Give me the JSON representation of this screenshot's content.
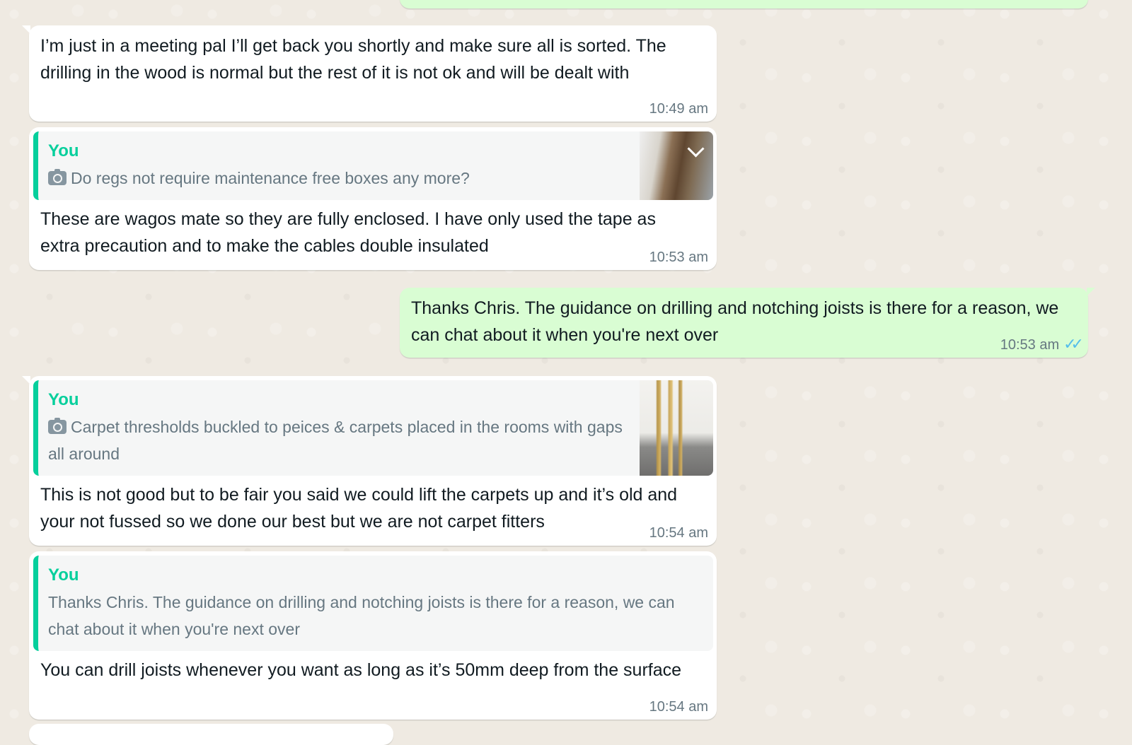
{
  "messages": [
    {
      "text": "I’m just in a meeting pal I’ll get back you shortly and make sure all is sorted. The drilling in the wood is normal but the rest of it is not ok and will be dealt with",
      "time": "10:49 am"
    },
    {
      "quote_author": "You",
      "quote_text": "Do regs not require maintenance free boxes any more?",
      "text": "These are wagos mate so they are fully enclosed. I have only used the tape as extra precaution and to make the cables double insulated",
      "time": "10:53 am"
    },
    {
      "text": "Thanks Chris. The guidance on drilling and notching joists is there for a reason, we can chat about it when you're next over",
      "time": "10:53 am"
    },
    {
      "quote_author": "You",
      "quote_text": "Carpet thresholds buckled to peices & carpets placed in the rooms with gaps all around",
      "text": "This is not good but to be fair you said we could lift the carpets up and it’s old and your not fussed so we done our best but we are not carpet fitters",
      "time": "10:54 am"
    },
    {
      "quote_author": "You",
      "quote_text": "Thanks Chris. The guidance on drilling and notching joists is there for a reason, we can chat about it when you're next over",
      "text": "You can drill joists whenever you want as long as it’s 50mm deep from the surface",
      "time": "10:54 am"
    }
  ],
  "colors": {
    "background": "#efeae2",
    "incoming_bubble": "#ffffff",
    "outgoing_bubble": "#d9fdd3",
    "quote_accent": "#06cf9c",
    "read_ticks": "#53bdeb"
  },
  "icons": [
    "camera-icon",
    "chevron-down-icon",
    "double-check-icon"
  ]
}
